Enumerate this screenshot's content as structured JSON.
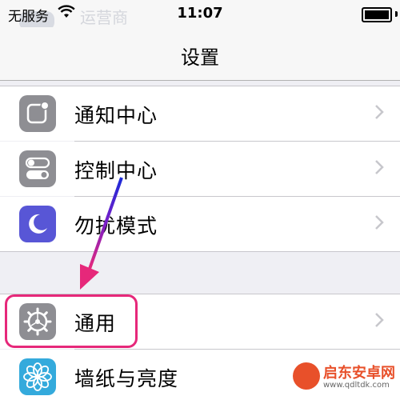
{
  "status_bar": {
    "carrier": "无服务",
    "time": "11:07",
    "ghost_label": "运营商"
  },
  "nav": {
    "title": "设置"
  },
  "groups": [
    {
      "items": [
        {
          "label": "通知中心",
          "icon": "notifications-icon",
          "color": "#8e8e93"
        },
        {
          "label": "控制中心",
          "icon": "control-center-icon",
          "color": "#8e8e93"
        },
        {
          "label": "勿扰模式",
          "icon": "moon-icon",
          "color": "#5856d6"
        }
      ]
    },
    {
      "items": [
        {
          "label": "通用",
          "icon": "gear-icon",
          "color": "#8e8e93",
          "highlighted": true
        },
        {
          "label": "墙纸与亮度",
          "icon": "wallpaper-flower-icon",
          "color": "#34aadc"
        }
      ]
    }
  ],
  "annotations": {
    "arrow": "arrow-pointing-down",
    "highlight_color": "#e6287a"
  },
  "watermark": {
    "brand": "启东安卓网",
    "url": "www.qdltdk.com"
  }
}
